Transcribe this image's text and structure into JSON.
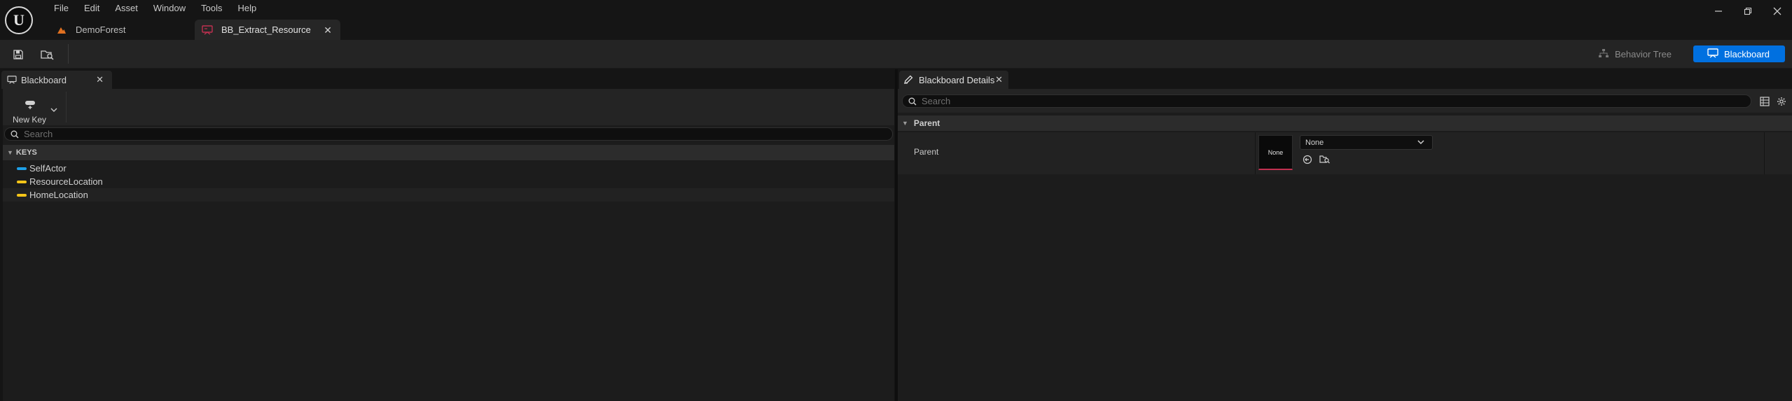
{
  "menu": [
    "File",
    "Edit",
    "Asset",
    "Window",
    "Tools",
    "Help"
  ],
  "doc_tabs": [
    {
      "label": "DemoForest",
      "icon": "level-icon",
      "active": false
    },
    {
      "label": "BB_Extract_Resource",
      "icon": "blackboard-asset-icon",
      "active": true
    }
  ],
  "window_controls": [
    "minimize-icon",
    "restore-icon",
    "close-icon"
  ],
  "toolbar": {
    "save_icon": "save-icon",
    "browse_icon": "browse-content-icon",
    "mode_behavior_tree": "Behavior Tree",
    "mode_blackboard": "Blackboard"
  },
  "left_panel": {
    "tab_label": "Blackboard",
    "new_key_label": "New Key",
    "search_placeholder": "Search",
    "section_label": "KEYS",
    "keys": [
      {
        "name": "SelfActor",
        "color": "#1ea0e8"
      },
      {
        "name": "ResourceLocation",
        "color": "#f5c518"
      },
      {
        "name": "HomeLocation",
        "color": "#f5c518"
      }
    ]
  },
  "right_panel": {
    "tab_label": "Blackboard Details",
    "search_placeholder": "Search",
    "category_label": "Parent",
    "property_name": "Parent",
    "thumbnail_text": "None",
    "combo_value": "None"
  },
  "colors": {
    "accent_blue": "#0070e0",
    "object_key": "#1ea0e8",
    "vector_key": "#f5c518",
    "asset_underline": "#c13050"
  }
}
